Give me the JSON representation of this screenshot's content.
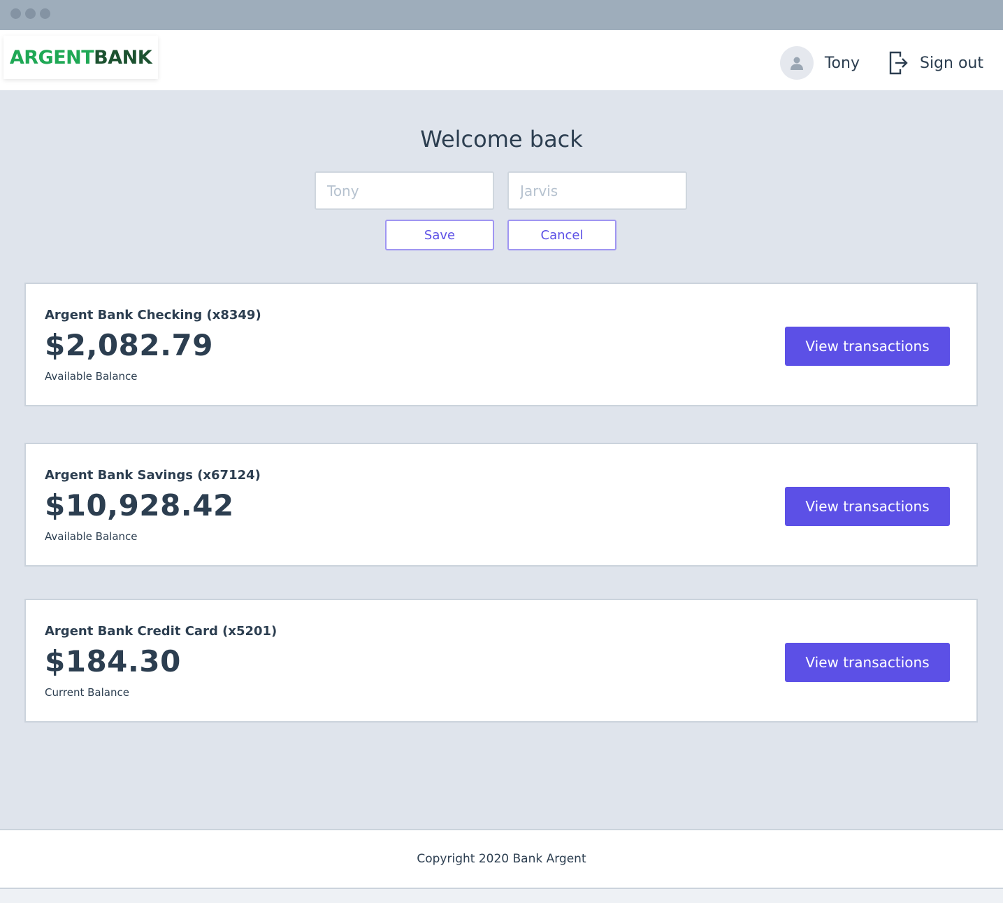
{
  "header": {
    "logo_part1": "ARGENT",
    "logo_part2": "BANK",
    "user_name": "Tony",
    "signout_label": "Sign out"
  },
  "welcome": {
    "title": "Welcome back",
    "first_name_placeholder": "Tony",
    "last_name_placeholder": "Jarvis",
    "save_label": "Save",
    "cancel_label": "Cancel"
  },
  "accounts": [
    {
      "title": "Argent Bank Checking (x8349)",
      "amount": "$2,082.79",
      "description": "Available Balance",
      "button_label": "View transactions"
    },
    {
      "title": "Argent Bank Savings (x67124)",
      "amount": "$10,928.42",
      "description": "Available Balance",
      "button_label": "View transactions"
    },
    {
      "title": "Argent Bank Credit Card (x5201)",
      "amount": "$184.30",
      "description": "Current Balance",
      "button_label": "View transactions"
    }
  ],
  "footer": {
    "copyright": "Copyright 2020 Bank Argent"
  },
  "colors": {
    "accent": "#5c50e6",
    "logo_green": "#1fa855",
    "logo_dark_green": "#1c5230",
    "background": "#dfe4ec",
    "text": "#2c3e50"
  },
  "icons": {
    "avatar": "user-circle-icon",
    "signout": "sign-out-icon"
  }
}
